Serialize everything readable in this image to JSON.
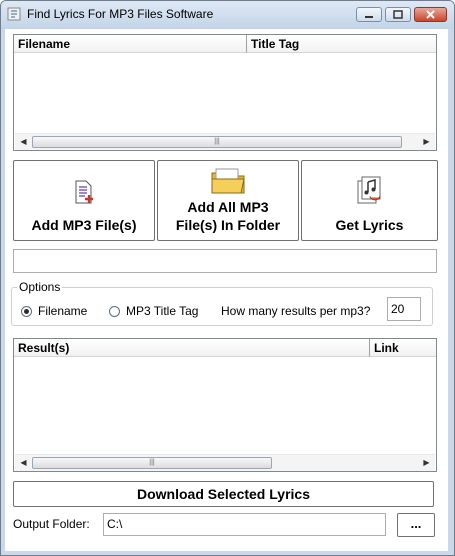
{
  "window": {
    "title": "Find Lyrics For MP3 Files Software"
  },
  "file_list": {
    "columns": [
      "Filename",
      "Title Tag"
    ],
    "rows": []
  },
  "buttons": {
    "add_files": "Add MP3 File(s)",
    "add_folder_line1": "Add All MP3",
    "add_folder_line2": "File(s) In Folder",
    "get_lyrics": "Get Lyrics"
  },
  "status": {
    "text": ""
  },
  "options": {
    "legend": "Options",
    "filename_label": "Filename",
    "mp3_tag_label": "MP3 Title Tag",
    "selected": "filename",
    "results_label": "How many results per mp3?",
    "results_value": "20"
  },
  "results_list": {
    "columns": [
      "Result(s)",
      "Link"
    ],
    "rows": []
  },
  "download": {
    "label": "Download Selected Lyrics"
  },
  "output": {
    "label": "Output Folder:",
    "value": "C:\\",
    "browse_label": "..."
  },
  "icons": {
    "app": "app-icon",
    "add_file": "document-add-icon",
    "folder": "folder-icon",
    "lyrics": "music-lyrics-icon"
  }
}
